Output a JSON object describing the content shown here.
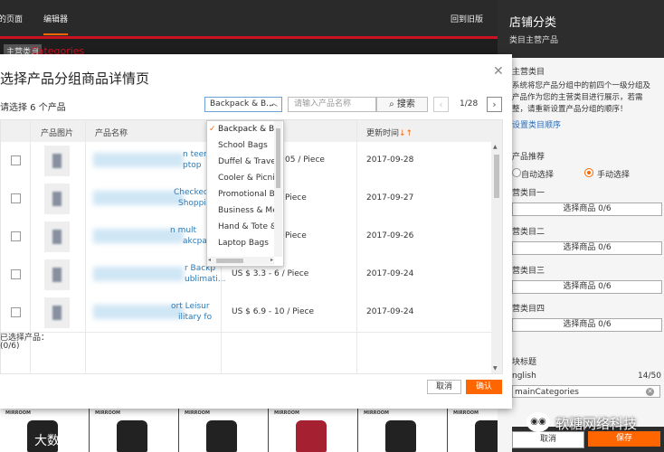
{
  "topbar": {
    "tab1": "的页面",
    "tab2": "编辑器",
    "back": "回到旧版"
  },
  "background": {
    "cat_tag": "主营类目",
    "cat_title": "Categories"
  },
  "bottom_products": {
    "brand": "MIRROOM"
  },
  "watermarks": {
    "left_logo": "K",
    "left_text": "大数跨境",
    "right_text": "软糖网络科技"
  },
  "panel": {
    "title": "店铺分类",
    "subtitle": "类目主营产品",
    "sec1": "主营类目",
    "desc1": "系统将您产品分组中的前四个一级分组及",
    "desc2": "产品作为您的主营类目进行展示，若需",
    "desc3": "整，请重新设置产品分组的顺序！",
    "link": "设置类目顺序",
    "sec2": "产品推荐",
    "radio_auto": "自动选择",
    "radio_manual": "手动选择",
    "cat1": "营类目一",
    "cat2": "营类目二",
    "cat3": "营类目三",
    "cat4": "营类目四",
    "select_btn": "选择商品 0/6",
    "module_title": "块标题",
    "lang": "nglish",
    "count": "14/50",
    "name_value": "mainCategories",
    "cancel": "取消",
    "save": "保存"
  },
  "modal": {
    "title": "选择产品分组商品详情页",
    "select_count": "请选择 6 个产品",
    "category_value": "Backpack & B...",
    "search_placeholder": "请输入产品名称",
    "search_btn": "搜索",
    "page": "1/28",
    "headers": {
      "image": "产品图片",
      "name": "产品名称",
      "updated": "更新时间"
    },
    "rows": [
      {
        "name1": "n teena",
        "name2": "ptop",
        "price": "05 / Piece",
        "date": "2017-09-28"
      },
      {
        "name1": "Checked",
        "name2": "Shoppin",
        "price": "Piece",
        "date": "2017-09-27"
      },
      {
        "name1": "n mult",
        "name2": "akcpac",
        "price": "Piece",
        "date": "2017-09-26"
      },
      {
        "name1": "r Backp",
        "name2": "ublimati...",
        "price": "US $ 3.3 - 6 / Piece",
        "date": "2017-09-24"
      },
      {
        "name1": "ort Leisur",
        "name2": "ilitary fo",
        "price": "US $ 6.9 - 10 / Piece",
        "date": "2017-09-24"
      }
    ],
    "selected_label": "已选择产品：",
    "selected_count": "(0/6)",
    "cancel": "取消",
    "ok": "确认"
  },
  "dropdown": {
    "items": [
      "Backpack & Bag",
      "School Bags",
      "Duffel & Travel B",
      "Cooler & Picnic",
      "Promotional Ba",
      "Business & Mes",
      "Hand & Tote & S",
      "Laptop Bags"
    ]
  },
  "colors": {
    "accent": "#ff6600",
    "link": "#2a7ab8"
  }
}
